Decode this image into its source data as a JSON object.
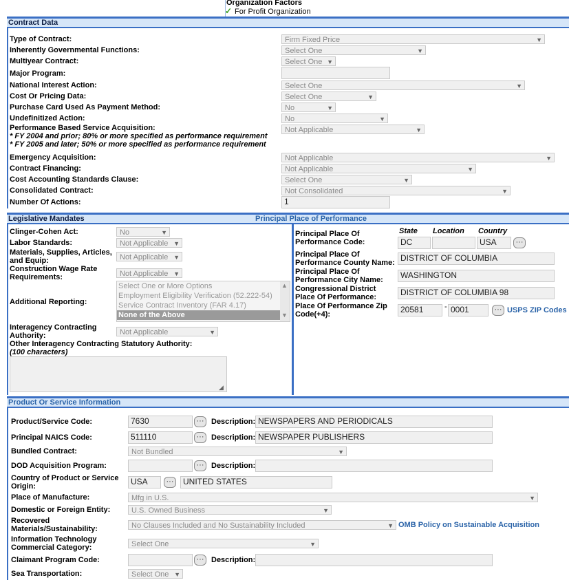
{
  "top": {
    "org_factors_title": "Organization Factors",
    "org_factors_value": "For Profit Organization"
  },
  "contract_data": {
    "header": "Contract Data",
    "type_of_contract": {
      "label": "Type of Contract:",
      "value": "Firm Fixed Price"
    },
    "inherently_govt": {
      "label": "Inherently Governmental Functions:",
      "value": "Select One"
    },
    "multiyear": {
      "label": "Multiyear Contract:",
      "value": "Select One"
    },
    "major_program": {
      "label": "Major Program:",
      "value": ""
    },
    "national_interest": {
      "label": "National Interest Action:",
      "value": "Select One"
    },
    "cost_pricing": {
      "label": "Cost Or Pricing Data:",
      "value": "Select One"
    },
    "purchase_card": {
      "label": "Purchase Card Used As Payment Method:",
      "value": "No"
    },
    "undefinitized": {
      "label": "Undefinitized Action:",
      "value": "No"
    },
    "pbsa": {
      "label": "Performance Based Service Acquisition:",
      "value": "Not Applicable",
      "note1": "* FY 2004 and prior; 80% or more specified as performance requirement",
      "note2": "* FY 2005 and later; 50% or more specified as performance requirement"
    },
    "emergency": {
      "label": "Emergency Acquisition:",
      "value": "Not Applicable"
    },
    "financing": {
      "label": "Contract Financing:",
      "value": "Not Applicable"
    },
    "cas_clause": {
      "label": "Cost Accounting Standards Clause:",
      "value": "Select One"
    },
    "consolidated": {
      "label": "Consolidated Contract:",
      "value": "Not Consolidated"
    },
    "num_actions": {
      "label": "Number Of Actions:",
      "value": "1"
    }
  },
  "legislative": {
    "header": "Legislative Mandates",
    "clinger_cohen": {
      "label": "Clinger-Cohen Act:",
      "value": "No"
    },
    "labor_standards": {
      "label": "Labor Standards:",
      "value": "Not Applicable"
    },
    "materials": {
      "label1": "Materials, Supplies, Articles,",
      "label2": "and Equip:",
      "value": "Not Applicable"
    },
    "construction_wage": {
      "label1": "Construction Wage Rate",
      "label2": "Requirements:",
      "value": "Not Applicable"
    },
    "additional_reporting": {
      "label": "Additional Reporting:",
      "options": [
        "Select One or More Options",
        "Employment Eligibility Verification (52.222-54)",
        "Service Contract Inventory (FAR 4.17)",
        "None of the Above"
      ]
    },
    "interagency": {
      "label1": "Interagency Contracting",
      "label2": "Authority:",
      "value": "Not Applicable"
    },
    "other_interagency": {
      "label": "Other Interagency Contracting Statutory Authority:",
      "note": "(100 characters)",
      "value": ""
    }
  },
  "place_of_performance": {
    "header": "Principal Place of Performance",
    "col_state": "State",
    "col_location": "Location",
    "col_country": "Country",
    "code": {
      "label1": "Principal Place Of",
      "label2": "Performance Code:",
      "state": "DC",
      "location": "",
      "country": "USA"
    },
    "county": {
      "label1": "Principal Place Of",
      "label2": "Performance County Name:",
      "value": "DISTRICT OF COLUMBIA"
    },
    "city": {
      "label1": "Principal Place Of",
      "label2": "Performance City Name:",
      "value": "WASHINGTON"
    },
    "congressional": {
      "label1": "Congressional District",
      "label2": "Place Of Performance:",
      "value": "DISTRICT OF COLUMBIA 98"
    },
    "zip": {
      "label1": "Place Of Performance Zip",
      "label2": "Code(+4):",
      "zip5": "20581",
      "dash": "-",
      "zip4": "0001",
      "link": "USPS ZIP Codes"
    }
  },
  "product_service": {
    "header": "Product Or Service Information",
    "desc_label": "Description:",
    "psc": {
      "label": "Product/Service Code:",
      "code": "7630",
      "desc": "NEWSPAPERS AND PERIODICALS"
    },
    "naics": {
      "label": "Principal NAICS Code:",
      "code": "511110",
      "desc": "NEWSPAPER PUBLISHERS"
    },
    "bundled": {
      "label": "Bundled Contract:",
      "value": "Not Bundled"
    },
    "dod_program": {
      "label": "DOD Acquisition Program:",
      "code": "",
      "desc": ""
    },
    "country_origin": {
      "label1": "Country of Product or Service",
      "label2": "Origin:",
      "code": "USA",
      "name": "UNITED STATES"
    },
    "place_manufacture": {
      "label": "Place of Manufacture:",
      "value": "Mfg in U.S."
    },
    "domestic_foreign": {
      "label": "Domestic or Foreign Entity:",
      "value": "U.S. Owned Business"
    },
    "recovered": {
      "label1": "Recovered",
      "label2": "Materials/Sustainability:",
      "value": "No Clauses Included and No Sustainability Included",
      "link": "OMB Policy on Sustainable Acquisition"
    },
    "it_category": {
      "label1": "Information Technology",
      "label2": "Commercial Category:",
      "value": "Select One"
    },
    "claimant": {
      "label": "Claimant Program Code:",
      "code": "",
      "desc": ""
    },
    "sea_transport": {
      "label": "Sea Transportation:",
      "value": "Select One"
    }
  },
  "icons": {
    "check": "check-icon",
    "lookup": "ellipsis-lookup-icon",
    "dropdown": "chevron-down-icon"
  },
  "colors": {
    "accent": "#3a6fc4",
    "header_bg": "#d6e6f8",
    "link": "#2a63a8",
    "check": "#3aa020"
  }
}
